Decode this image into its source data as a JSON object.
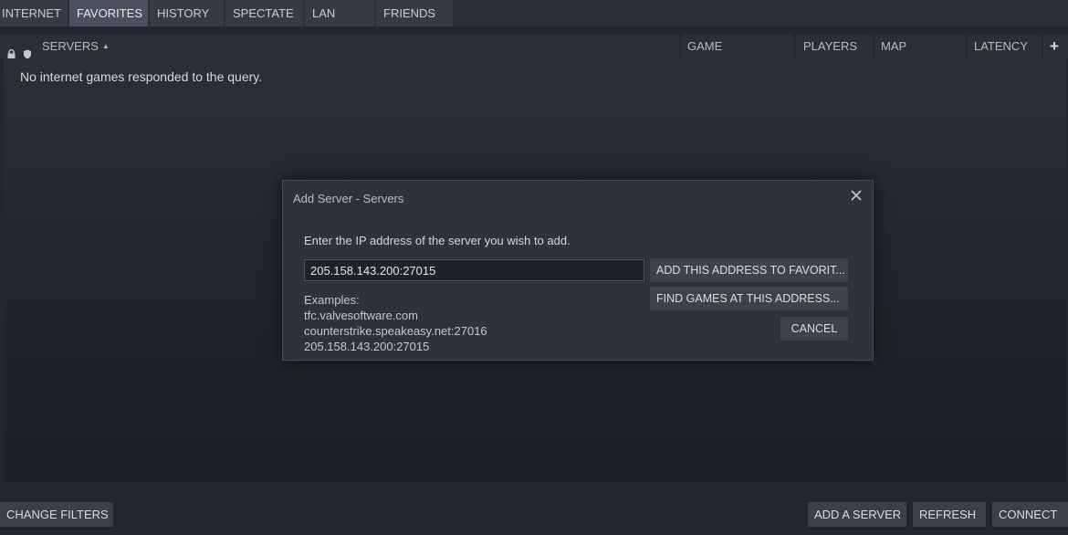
{
  "tabs": [
    {
      "label": "INTERNET",
      "active": false
    },
    {
      "label": "FAVORITES",
      "active": true
    },
    {
      "label": "HISTORY",
      "active": false
    },
    {
      "label": "SPECTATE",
      "active": false
    },
    {
      "label": "LAN",
      "active": false
    },
    {
      "label": "FRIENDS",
      "active": false
    }
  ],
  "columns": {
    "servers": "SERVERS",
    "game": "GAME",
    "players": "PLAYERS",
    "map": "MAP",
    "latency": "LATENCY",
    "add": "+"
  },
  "list": {
    "empty_message": "No internet games responded to the query."
  },
  "dialog": {
    "title": "Add Server - Servers",
    "prompt": "Enter the IP address of the server you wish to add.",
    "ip_value": "205.158.143.200:27015",
    "examples": [
      "Examples:",
      "tfc.valvesoftware.com",
      "counterstrike.speakeasy.net:27016",
      "205.158.143.200:27015"
    ],
    "add_favorites_label": "ADD THIS ADDRESS TO FAVORIT...",
    "find_games_label": "FIND GAMES AT THIS ADDRESS...",
    "cancel_label": "CANCEL"
  },
  "bottom": {
    "change_filters": "CHANGE FILTERS",
    "add_server": "ADD A SERVER",
    "refresh": "REFRESH",
    "connect": "CONNECT"
  },
  "colors": {
    "background": "#23262d",
    "tab_active": "#4a505c",
    "button": "#3a3f49",
    "dialog": "#2e323b"
  },
  "icons": [
    "lock-icon",
    "shield-icon",
    "sort-up-icon",
    "close-icon",
    "plus-icon"
  ]
}
